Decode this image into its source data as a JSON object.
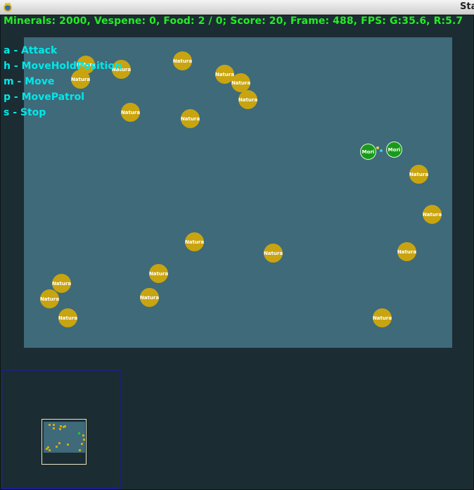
{
  "window": {
    "title": "Sta"
  },
  "status": {
    "text": "Minerals: 2000, Vespene: 0, Food: 2 / 0; Score: 20, Frame: 488, FPS: G:35.6, R:5.7"
  },
  "commands": [
    "a - Attack",
    "h - MoveHoldPosition",
    "m - Move",
    "p - MovePatrol",
    "s - Stop"
  ],
  "units": {
    "mineral_label": "Natura",
    "player_label": "Mori",
    "colors": {
      "mineral": "#c8a410",
      "player": "#1a9a1a",
      "map": "#3e6a7a",
      "background": "#1c2c33",
      "status_text": "#22ee22",
      "command_text": "#00e8e8",
      "minimap_border": "#1414e0"
    }
  },
  "icons": {
    "app": "pygame-snake-icon"
  }
}
